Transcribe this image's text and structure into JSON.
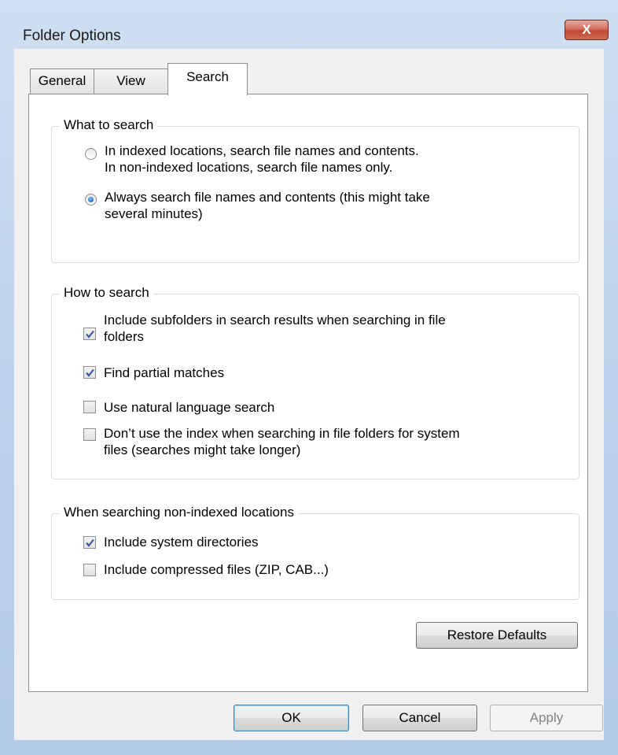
{
  "window": {
    "title": "Folder Options",
    "close_label": "X"
  },
  "tabs": [
    {
      "label": "General"
    },
    {
      "label": "View"
    },
    {
      "label": "Search",
      "selected": true
    }
  ],
  "what_to_search": {
    "title": "What to search",
    "options": [
      {
        "line1": "In indexed locations, search file names and contents.",
        "line2": "In non-indexed locations, search file names only.",
        "selected": false
      },
      {
        "line1": "Always search file names and contents (this might take",
        "line2": "several minutes)",
        "selected": true
      }
    ]
  },
  "how_to_search": {
    "title": "How to search",
    "options": [
      {
        "line1": "Include subfolders in search results when searching in file",
        "line2": "folders",
        "checked": true
      },
      {
        "line1": "Find partial matches",
        "checked": true
      },
      {
        "line1": "Use natural language search",
        "checked": false
      },
      {
        "line1": "Don’t use the index when searching in file folders for system",
        "line2": "files (searches might take longer)",
        "checked": false
      }
    ]
  },
  "non_indexed": {
    "title": "When searching non-indexed locations",
    "options": [
      {
        "line1": "Include system directories",
        "checked": true
      },
      {
        "line1": "Include compressed files (ZIP, CAB...)",
        "checked": false
      }
    ]
  },
  "buttons": {
    "restore_defaults": "Restore Defaults",
    "ok": "OK",
    "cancel": "Cancel",
    "apply": "Apply"
  }
}
